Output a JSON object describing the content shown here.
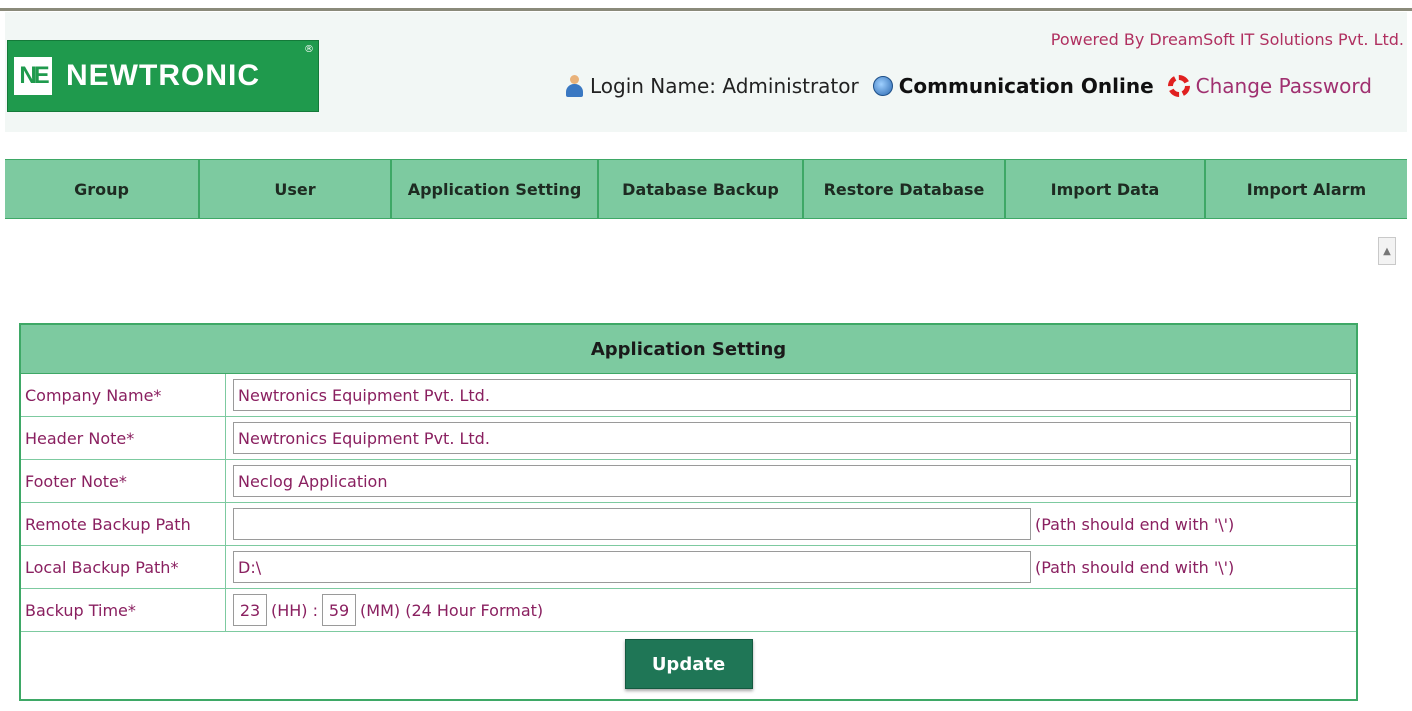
{
  "header": {
    "logo_text": "NEWTRONIC",
    "logo_mark": "NE",
    "logo_reg": "®",
    "powered_by": "Powered By DreamSoft IT Solutions Pvt. Ltd.",
    "login_label": "Login Name: Administrator",
    "communication_status": "Communication Online",
    "change_password": "Change Password"
  },
  "nav": {
    "items": [
      {
        "label": "Group"
      },
      {
        "label": "User"
      },
      {
        "label": "Application Setting"
      },
      {
        "label": "Database Backup"
      },
      {
        "label": "Restore Database"
      },
      {
        "label": "Import Data"
      },
      {
        "label": "Import Alarm"
      }
    ]
  },
  "form": {
    "title": "Application Setting",
    "company_name": {
      "label": "Company Name*",
      "value": "Newtronics Equipment Pvt. Ltd."
    },
    "header_note": {
      "label": "Header Note*",
      "value": "Newtronics Equipment Pvt. Ltd."
    },
    "footer_note": {
      "label": "Footer Note*",
      "value": "Neclog Application"
    },
    "remote_backup_path": {
      "label": "Remote Backup Path",
      "value": "",
      "hint": "(Path should end with '\\')"
    },
    "local_backup_path": {
      "label": "Local Backup Path*",
      "value": "D:\\",
      "hint": "(Path should end with '\\')"
    },
    "backup_time": {
      "label": "Backup Time*",
      "hour": "23",
      "hour_unit": "(HH) :",
      "minute": "59",
      "minute_unit": "(MM) (24 Hour Format)"
    },
    "update_label": "Update"
  },
  "icons": {
    "user": "user-icon",
    "communication": "globe-icon",
    "password": "lifebuoy-icon"
  },
  "colors": {
    "brand_green": "#1f9a4d",
    "nav_green": "#7dcaa0",
    "button_green": "#1f7656",
    "label_text": "#8a2060"
  }
}
